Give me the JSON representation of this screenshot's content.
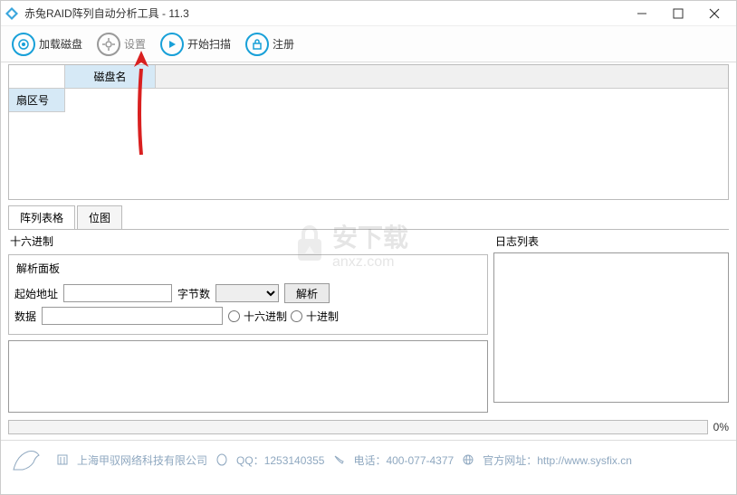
{
  "window": {
    "title": "赤兔RAID阵列自动分析工具 - 11.3"
  },
  "toolbar": {
    "load_disk": "加载磁盘",
    "settings": "设置",
    "start_scan": "开始扫描",
    "register": "注册"
  },
  "table": {
    "col_diskname": "磁盘名",
    "row_sector": "扇区号"
  },
  "tabs": {
    "array_grid": "阵列表格",
    "bitmap": "位图"
  },
  "hex_panel": {
    "title": "十六进制",
    "parse_title": "解析面板",
    "start_addr_label": "起始地址",
    "bytes_label": "字节数",
    "parse_btn": "解析",
    "data_label": "数据",
    "radio_hex": "十六进制",
    "radio_dec": "十进制"
  },
  "log_panel": {
    "title": "日志列表"
  },
  "progress": {
    "percent": "0%"
  },
  "footer": {
    "company": "上海甲驭网络科技有限公司",
    "qq_label": "QQ：",
    "qq": "1253140355",
    "phone_label": "电话：",
    "phone": "400-077-4377",
    "site_label": "官方网址：",
    "site_url": "http://www.sysfix.cn"
  },
  "watermark": {
    "text": "安下载",
    "domain": "anxz.com"
  }
}
